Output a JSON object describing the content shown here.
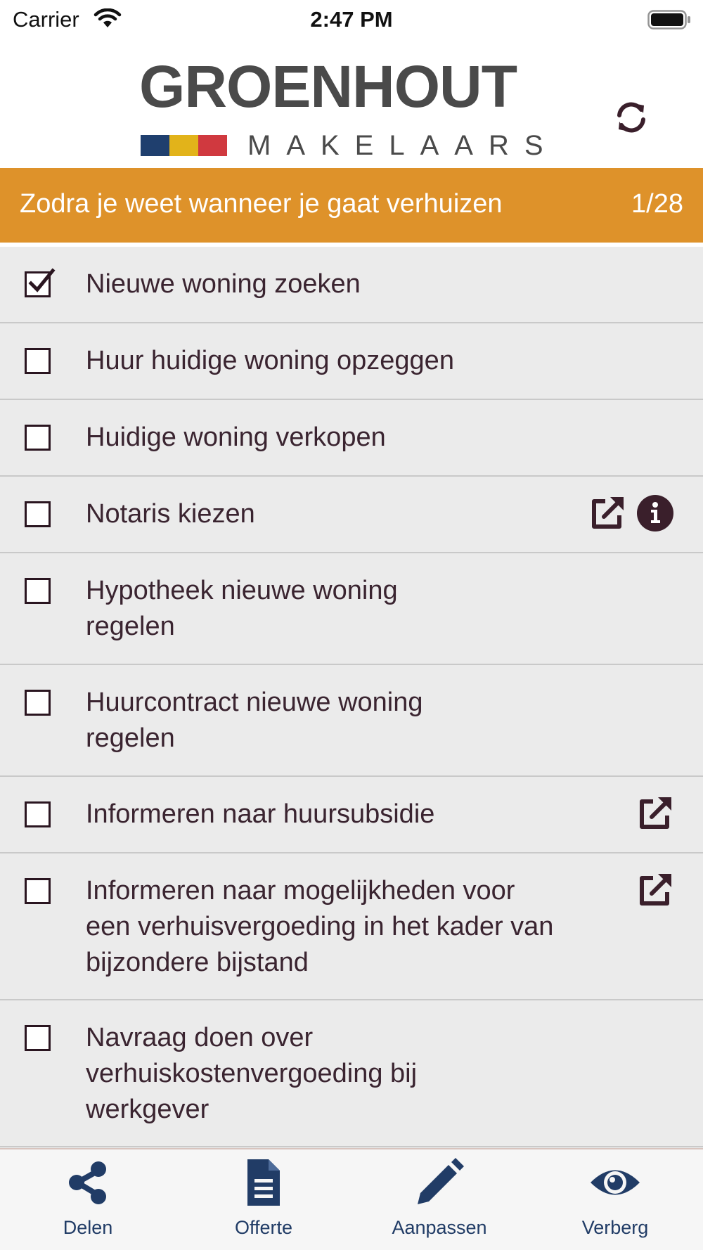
{
  "status_bar": {
    "carrier": "Carrier",
    "time": "2:47 PM"
  },
  "header": {
    "logo_name": "GROENHOUT",
    "logo_subtitle": "MAKELAARS",
    "logo_colors": [
      "#1f3f6e",
      "#e2b31a",
      "#d0393f"
    ],
    "refresh_icon": "refresh-icon"
  },
  "section": {
    "title": "Zodra je weet wanneer je gaat verhuizen",
    "counter": "1/28",
    "color": "#de922a"
  },
  "checklist": [
    {
      "label": "Nieuwe woning zoeken",
      "checked": true,
      "icons": []
    },
    {
      "label": "Huur huidige woning opzeggen",
      "checked": false,
      "icons": []
    },
    {
      "label": "Huidige woning verkopen",
      "checked": false,
      "icons": []
    },
    {
      "label": "Notaris kiezen",
      "checked": false,
      "icons": [
        "external-link-icon",
        "info-icon"
      ]
    },
    {
      "label": "Hypotheek nieuwe woning regelen",
      "checked": false,
      "icons": []
    },
    {
      "label": "Huurcontract nieuwe woning regelen",
      "checked": false,
      "icons": []
    },
    {
      "label": "Informeren naar huursubsidie",
      "checked": false,
      "icons": [
        "external-link-icon"
      ]
    },
    {
      "label": "Informeren naar mogelijkheden voor een verhuisvergoeding in het kader van bijzondere bijstand",
      "checked": false,
      "icons": [
        "external-link-icon"
      ]
    },
    {
      "label": "Navraag doen over verhuiskostenvergoeding bij werkgever",
      "checked": false,
      "icons": []
    }
  ],
  "tab_bar": {
    "color": "#213c66",
    "tabs": [
      {
        "label": "Delen",
        "icon": "share-icon"
      },
      {
        "label": "Offerte",
        "icon": "document-icon"
      },
      {
        "label": "Aanpassen",
        "icon": "pencil-icon"
      },
      {
        "label": "Verberg",
        "icon": "eye-icon"
      }
    ]
  }
}
